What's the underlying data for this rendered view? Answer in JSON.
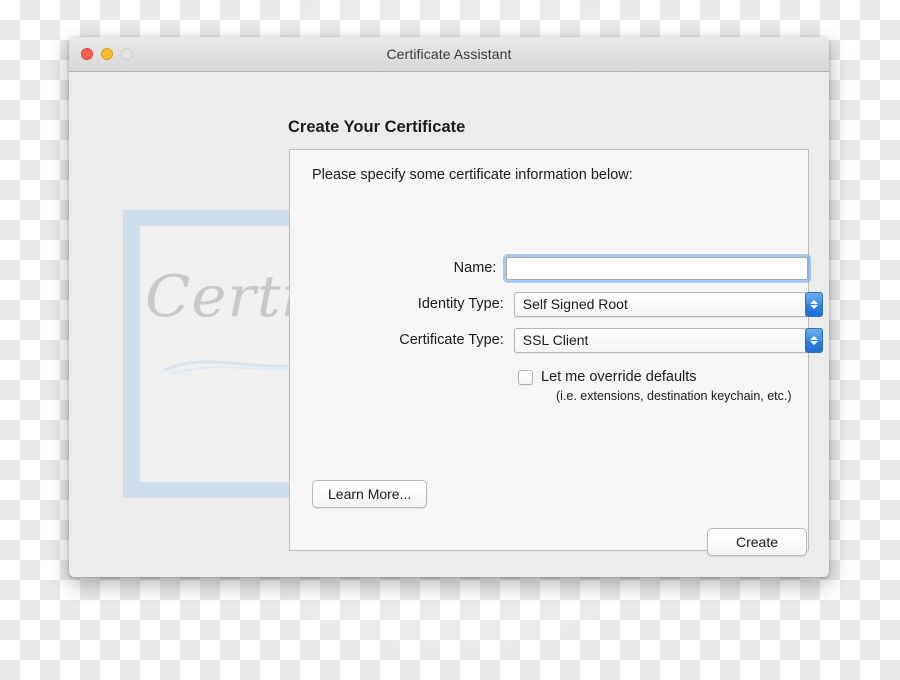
{
  "window": {
    "title": "Certificate Assistant",
    "traffic_lights": [
      {
        "name": "close",
        "color": "#ff5f57"
      },
      {
        "name": "minimize",
        "color": "#febc2e"
      },
      {
        "name": "zoom",
        "color": "#e4e4e4"
      }
    ]
  },
  "heading": "Create Your Certificate",
  "panel": {
    "prompt": "Please specify some certificate information below:",
    "fields": [
      {
        "label": "Name:",
        "type": "text",
        "value": "",
        "placeholder": "",
        "focused": true
      },
      {
        "label": "Identity Type:",
        "type": "popup",
        "value": "Self Signed Root"
      },
      {
        "label": "Certificate Type:",
        "type": "popup",
        "value": "SSL Client"
      }
    ],
    "checkbox": {
      "label": "Let me override defaults",
      "sublabel": "(i.e. extensions, destination keychain, etc.)",
      "checked": false
    },
    "learn_more_label": "Learn More..."
  },
  "footer": {
    "create_label": "Create"
  },
  "decoration": {
    "watermark_text": "Certificate",
    "frame_color": "#c9dced",
    "seal_color": "#f7f5e6"
  },
  "colors": {
    "accent_blue": "#3d8fe8",
    "focus_ring": "#5fa6eb",
    "window_chrome": "#ececec",
    "panel_bg": "#f6f6f6"
  }
}
